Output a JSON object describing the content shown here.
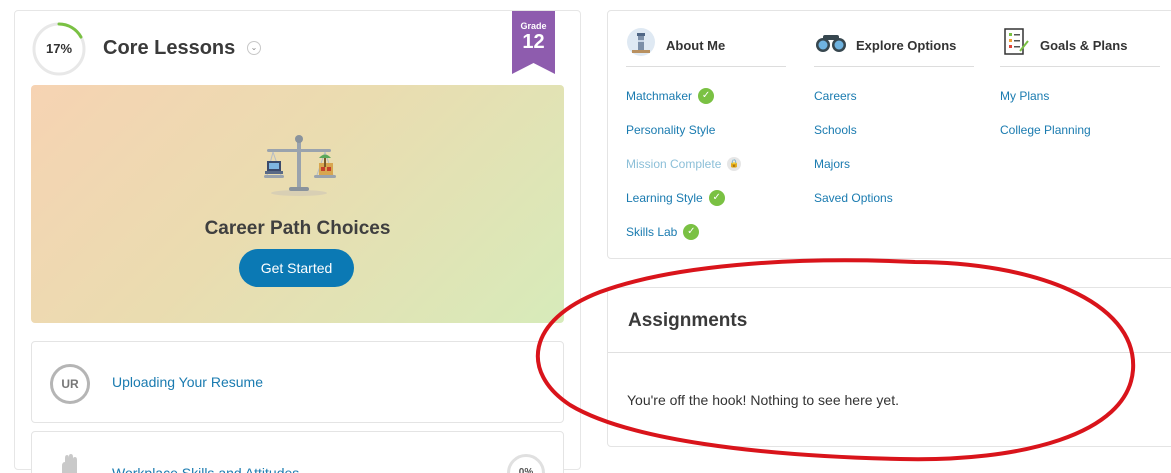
{
  "core": {
    "progress_label": "17%",
    "progress_value": 0.17,
    "title": "Core Lessons",
    "grade_label": "Grade",
    "grade_number": "12",
    "hero_title": "Career Path Choices",
    "hero_button": "Get Started",
    "lessons": [
      {
        "badge": "UR",
        "title": "Uploading Your Resume"
      },
      {
        "title": "Workplace Skills and Attitudes",
        "progress": "0%"
      }
    ]
  },
  "nav": {
    "about_me": {
      "title": "About Me",
      "items": [
        {
          "label": "Matchmaker",
          "status": "complete"
        },
        {
          "label": "Personality Style",
          "status": ""
        },
        {
          "label": "Mission Complete",
          "status": "locked"
        },
        {
          "label": "Learning Style",
          "status": "complete"
        },
        {
          "label": "Skills Lab",
          "status": "complete"
        }
      ]
    },
    "explore": {
      "title": "Explore Options",
      "items": [
        "Careers",
        "Schools",
        "Majors",
        "Saved Options"
      ]
    },
    "goals": {
      "title": "Goals & Plans",
      "items": [
        "My Plans",
        "College Planning"
      ]
    }
  },
  "assignments": {
    "title": "Assignments",
    "empty_message": "You're off the hook! Nothing to see here yet."
  },
  "colors": {
    "link": "#1a7bb0",
    "accent_green": "#7ac143",
    "grade_purple": "#8e5cae",
    "button_blue": "#0b79b4",
    "annotation_red": "#d9141b"
  },
  "icons": {
    "check": "✓",
    "lock": "🔒",
    "chevron": "⌄"
  }
}
